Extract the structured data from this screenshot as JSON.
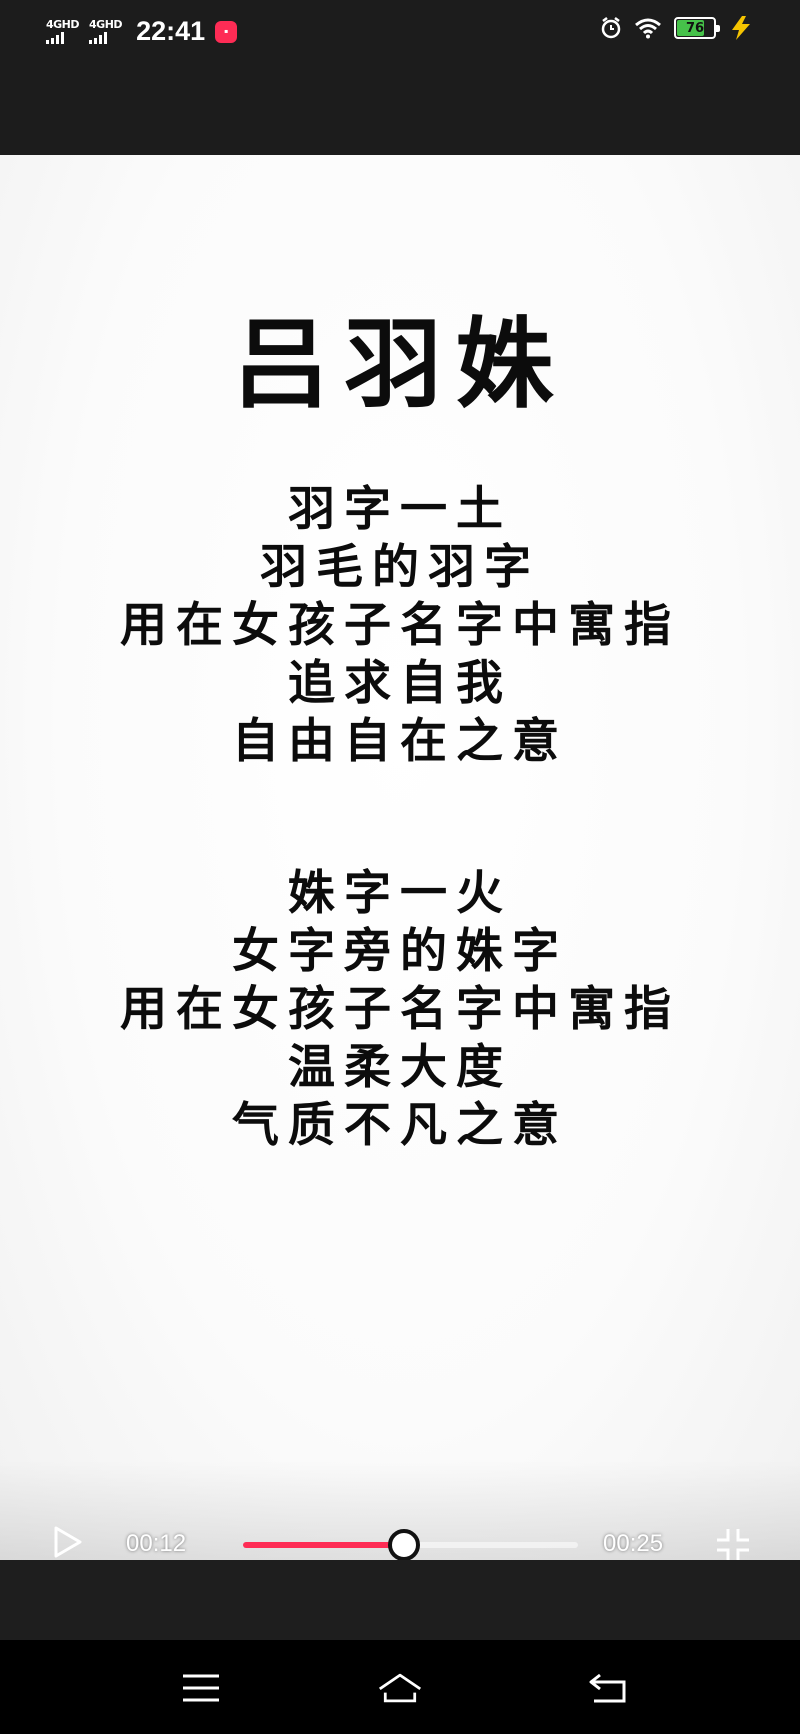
{
  "status_bar": {
    "network_1": "4GHD",
    "network_2": "4GHD",
    "time": "22:41",
    "battery_level": "76",
    "battery_color": "#46c24a"
  },
  "poem": {
    "title": "吕羽姝",
    "stanza1": [
      "羽字一土",
      "羽毛的羽字",
      "用在女孩子名字中寓指",
      "追求自我",
      "自由自在之意"
    ],
    "stanza2": [
      "姝字一火",
      "女字旁的姝字",
      "用在女孩子名字中寓指",
      "温柔大度",
      "气质不凡之意"
    ]
  },
  "player": {
    "current_time": "00:12",
    "total_time": "00:25",
    "progress": 0.48,
    "accent_color": "#fe2c55"
  },
  "nav": {
    "icons": [
      "menu-icon",
      "home-icon",
      "back-icon"
    ]
  }
}
